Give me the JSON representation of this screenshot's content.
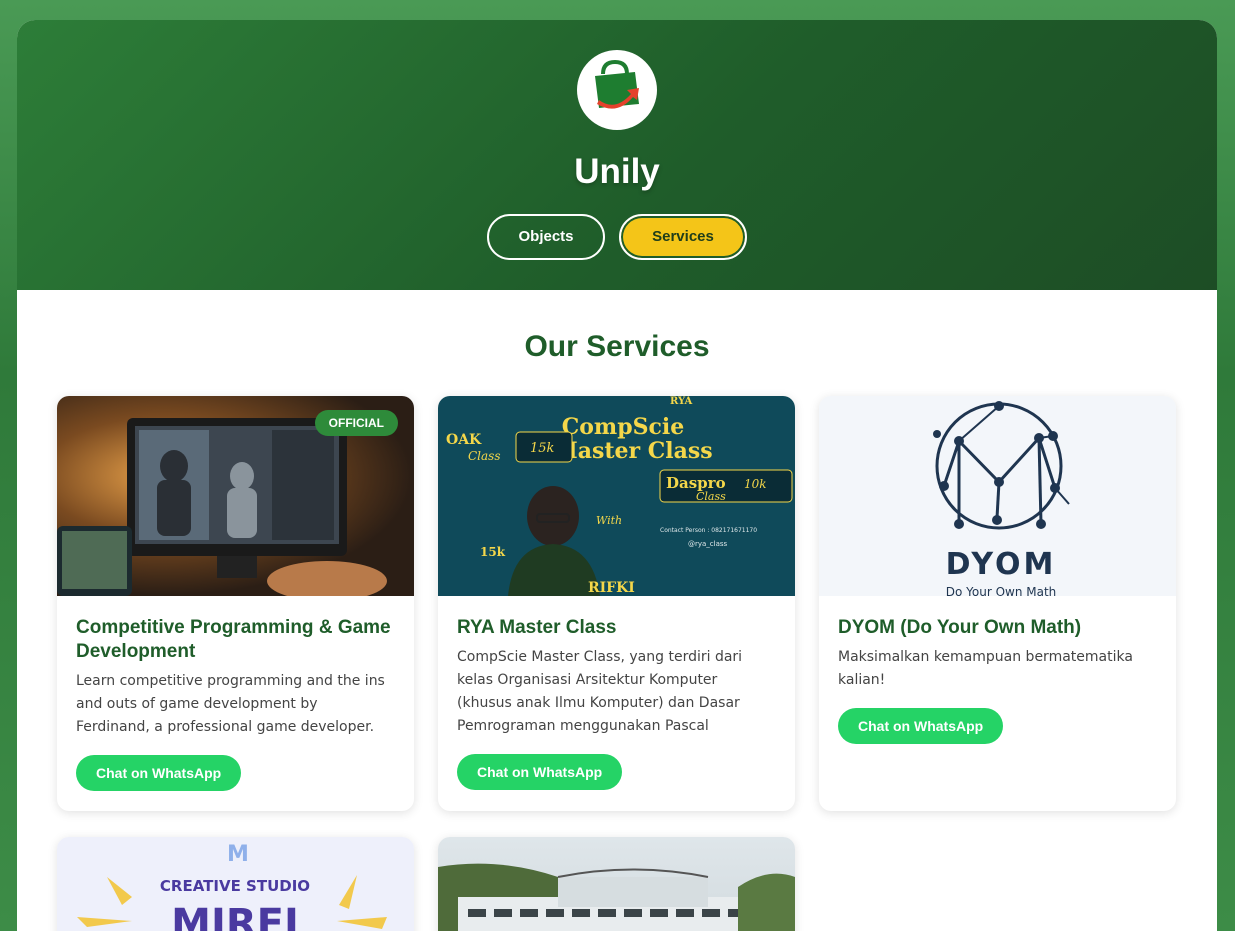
{
  "header": {
    "brand": "Unily",
    "logo_icon": "shopping-bag-icon",
    "tabs": [
      {
        "label": "Objects",
        "active": false
      },
      {
        "label": "Services",
        "active": true
      }
    ]
  },
  "section": {
    "title": "Our Services"
  },
  "cards": [
    {
      "title": "Competitive Programming & Game Development",
      "description": "Learn competitive programming and the ins and outs of game development by Ferdinand, a professional game developer.",
      "badge": "OFFICIAL",
      "button": "Chat on WhatsApp"
    },
    {
      "title": "RYA Master Class",
      "description": "CompScie Master Class, yang terdiri dari kelas Organisasi Arsitektur Komputer (khusus anak Ilmu Komputer) dan Dasar Pemrograman menggunakan Pascal",
      "button": "Chat on WhatsApp",
      "image_text": {
        "line1": "CompScie",
        "line2": "Master Class",
        "oak": "OAK",
        "oak_sub": "Class",
        "oak_price": "15k",
        "daspro": "Daspro",
        "daspro_sub": "Class",
        "daspro_price": "10k",
        "contact": "Contact Person : 082171671170",
        "handle": "@rya_class",
        "with": "With",
        "rya": "RYA"
      }
    },
    {
      "title": "DYOM (Do Your Own Math)",
      "description": "Maksimalkan kemampuan bermatematika kalian!",
      "button": "Chat on WhatsApp",
      "image_text": {
        "logo": "DYOM",
        "tagline": "Do Your Own Math"
      }
    },
    {
      "image_text": {
        "studio": "CREATIVE STUDIO",
        "name": "MIREI"
      }
    },
    {
      "image_alt": "building"
    }
  ],
  "colors": {
    "primary_green": "#1f5d2a",
    "accent_yellow": "#f4c518",
    "whatsapp_green": "#25d366"
  }
}
